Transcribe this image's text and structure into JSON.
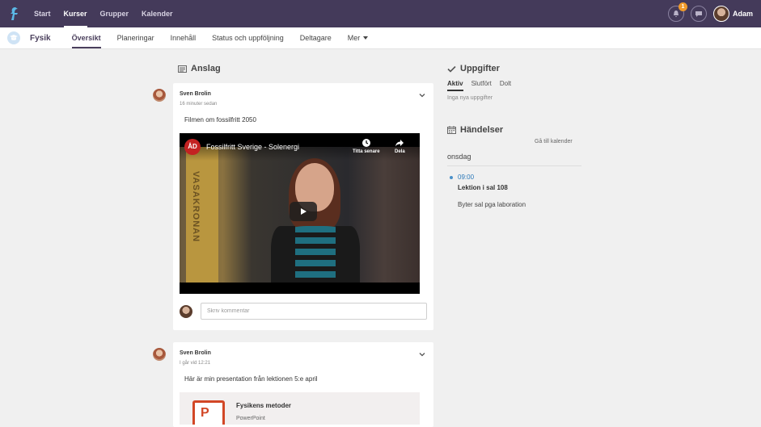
{
  "topbar": {
    "nav": [
      {
        "label": "Start",
        "active": false
      },
      {
        "label": "Kurser",
        "active": true
      },
      {
        "label": "Grupper",
        "active": false
      },
      {
        "label": "Kalender",
        "active": false
      }
    ],
    "notifications_count": "1",
    "user_name": "Adam"
  },
  "subnav": {
    "course_name": "Fysik",
    "items": [
      {
        "label": "Översikt",
        "active": true
      },
      {
        "label": "Planeringar",
        "active": false
      },
      {
        "label": "Innehåll",
        "active": false
      },
      {
        "label": "Status och uppföljning",
        "active": false
      },
      {
        "label": "Deltagare",
        "active": false
      },
      {
        "label": "Mer",
        "active": false
      }
    ]
  },
  "announcements": {
    "title": "Anslag",
    "posts": [
      {
        "author": "Sven Brolin",
        "time": "16 minuter sedan",
        "text": "Filmen om fossilfritt 2050",
        "video": {
          "channel_logo": "ÅD",
          "title": "Fossilfritt Sverige - Solenergi",
          "watch_later": "Titta senare",
          "share": "Dela",
          "banner_text": "VASAKRONAN"
        },
        "comment_placeholder": "Skriv kommentar"
      },
      {
        "author": "Sven Brolin",
        "time": "I går vid 12:21",
        "text": "Här är min presentation från lektionen 5:e april",
        "attachment": {
          "title": "Fysikens metoder",
          "type": "PowerPoint"
        }
      }
    ]
  },
  "tasks": {
    "title": "Uppgifter",
    "tabs": [
      {
        "label": "Aktiv",
        "active": true
      },
      {
        "label": "Slutfört",
        "active": false
      },
      {
        "label": "Dolt",
        "active": false
      }
    ],
    "empty_text": "Inga nya uppgifter"
  },
  "events": {
    "title": "Händelser",
    "calendar_link": "Gå till kalender",
    "day": "onsdag",
    "items": [
      {
        "time": "09:00",
        "title": "Lektion i sal 108",
        "description": "Byter sal pga laboration"
      }
    ]
  },
  "colors": {
    "topbar": "#443a5a",
    "accent": "#4a3f5c",
    "badge": "#f09a2b",
    "event_time": "#2a78b8"
  }
}
